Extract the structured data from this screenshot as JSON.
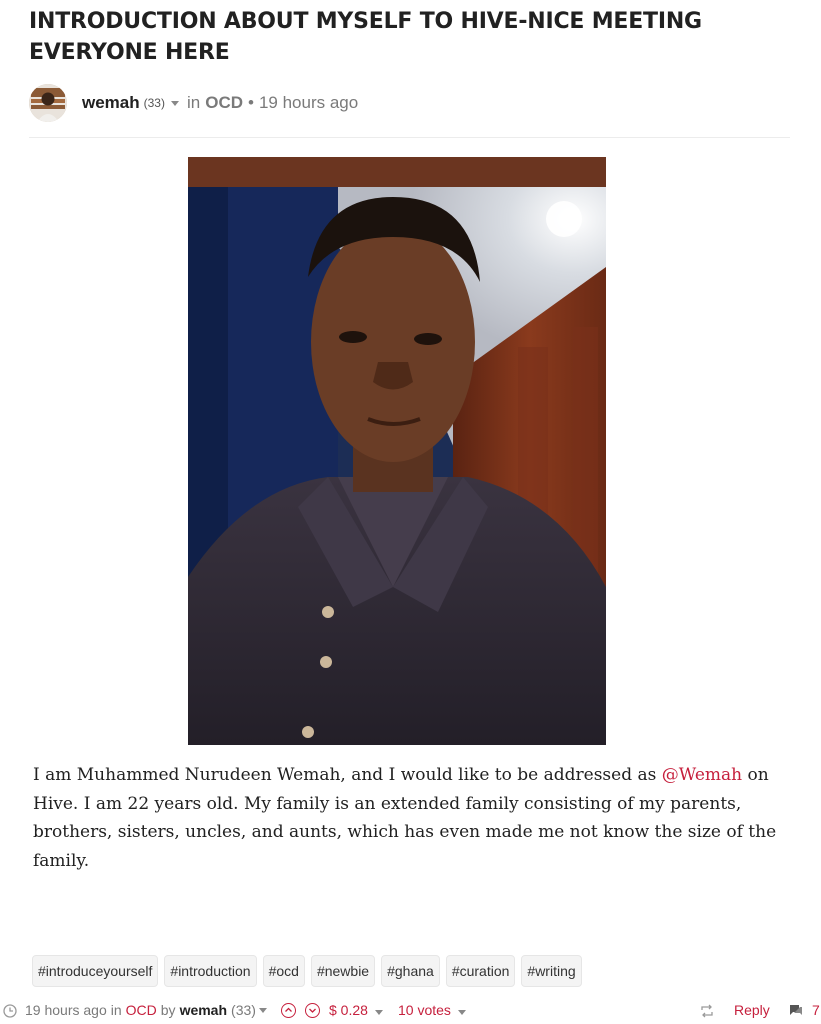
{
  "post": {
    "title": "INTRODUCTION ABOUT MYSELF TO HIVE-NICE MEETING EVERYONE HERE",
    "author": "wemah",
    "reputation": "(33)",
    "in_label": "in",
    "community": "OCD",
    "separator": "•",
    "time_ago": "19 hours ago",
    "body_before_mention": "I am Muhammed Nurudeen Wemah, and I would like to be addressed as ",
    "mention": "@Wemah",
    "body_after_mention": " on Hive. I am 22 years old. My family is an extended family consisting of my parents, brothers, sisters, uncles, and aunts, which has even made me not know the size of the family.",
    "tags": [
      "#introduceyourself",
      "#introduction",
      "#ocd",
      "#newbie",
      "#ghana",
      "#curation",
      "#writing"
    ]
  },
  "footer": {
    "time_ago": "19 hours ago",
    "in_label": "in",
    "community": "OCD",
    "by_label": "by",
    "author": "wemah",
    "reputation": "(33)",
    "payout": "$ 0.28",
    "votes": "10 votes",
    "reply": "Reply",
    "comment_count": "7"
  },
  "icons": {
    "clock": "clock-icon",
    "upvote": "upvote-icon",
    "downvote": "downvote-icon",
    "reblog": "reblog-icon",
    "comments": "comment-icon"
  },
  "colors": {
    "accent": "#c6203d",
    "text": "#212121",
    "muted": "#7a7a7a"
  }
}
